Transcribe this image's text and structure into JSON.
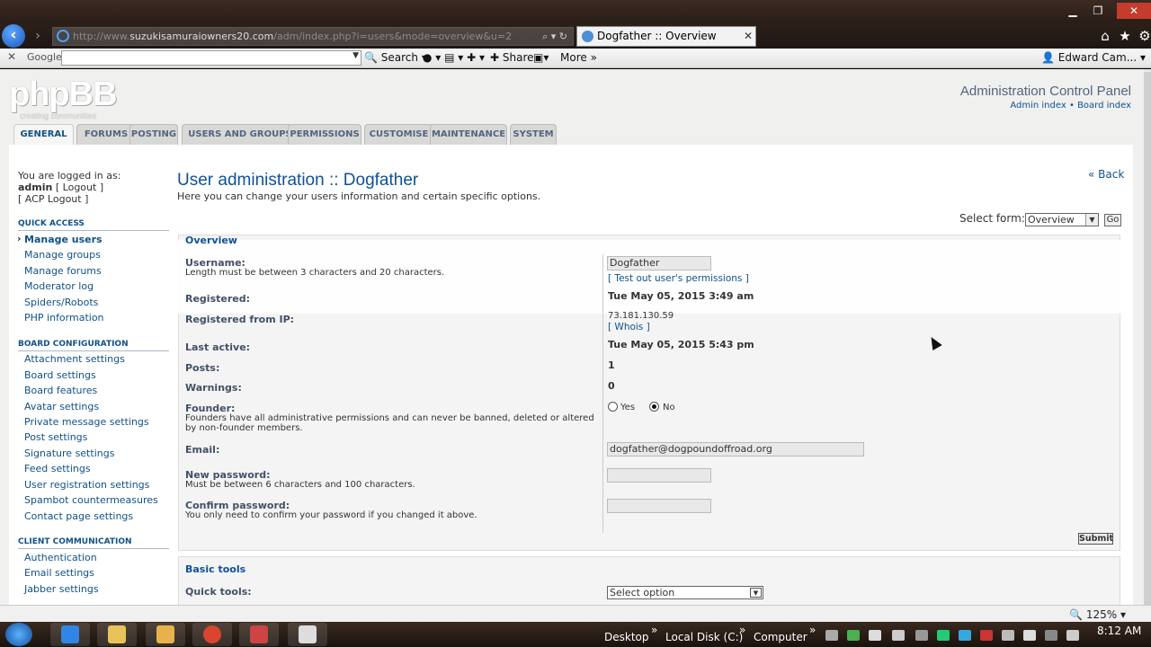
{
  "browser": {
    "address_domain": "suzukisamuraiowners20.com",
    "address_rest": "/adm/index.php?i=users&mode=overview&u=2",
    "tab_title": "Dogfather :: Overview",
    "toolbar_search": "Search",
    "toolbar_share": "Share",
    "toolbar_more": "More",
    "toolbar_user": "Edward Cam...",
    "google_label": "Google",
    "zoom": "125%"
  },
  "header": {
    "logo": "phpBB",
    "logo_tagline": "creating communities",
    "acp_title": "Administration Control Panel",
    "admin_index": "Admin index",
    "board_index": "Board index",
    "bullet": "•"
  },
  "tabs": [
    "GENERAL",
    "FORUMS",
    "POSTING",
    "USERS AND GROUPS",
    "PERMISSIONS",
    "CUSTOMISE",
    "MAINTENANCE",
    "SYSTEM"
  ],
  "sidebar": {
    "logged_in_as": "You are logged in as:",
    "username": "admin",
    "logout": "[ Logout ]",
    "acp_logout": "[ ACP Logout ]",
    "quick_access_title": "QUICK ACCESS",
    "quick_access": [
      "Manage users",
      "Manage groups",
      "Manage forums",
      "Moderator log",
      "Spiders/Robots",
      "PHP information"
    ],
    "board_config_title": "BOARD CONFIGURATION",
    "board_config": [
      "Attachment settings",
      "Board settings",
      "Board features",
      "Avatar settings",
      "Private message settings",
      "Post settings",
      "Signature settings",
      "Feed settings",
      "User registration settings",
      "Spambot countermeasures",
      "Contact page settings"
    ],
    "client_comm_title": "CLIENT COMMUNICATION",
    "client_comm": [
      "Authentication",
      "Email settings",
      "Jabber settings"
    ]
  },
  "content": {
    "title": "User administration :: Dogfather",
    "description": "Here you can change your users information and certain specific options.",
    "back": "« Back",
    "select_form_label": "Select form:",
    "select_form_value": "Overview",
    "go": "Go",
    "overview_legend": "Overview",
    "username_label": "Username:",
    "username_hint": "Length must be between 3 characters and 20 characters.",
    "username_value": "Dogfather",
    "test_permissions": "[ Test out user's permissions ]",
    "registered_label": "Registered:",
    "registered_value": "Tue May 05, 2015 3:49 am",
    "registered_ip_label": "Registered from IP:",
    "registered_ip_value": "73.181.130.59",
    "whois": "[ Whois ]",
    "last_active_label": "Last active:",
    "last_active_value": "Tue May 05, 2015 5:43 pm",
    "posts_label": "Posts:",
    "posts_value": "1",
    "warnings_label": "Warnings:",
    "warnings_value": "0",
    "founder_label": "Founder:",
    "founder_hint": "Founders have all administrative permissions and can never be banned, deleted or altered by non-founder members.",
    "founder_yes": "Yes",
    "founder_no": "No",
    "email_label": "Email:",
    "email_value": "dogfather@dogpoundoffroad.org",
    "new_password_label": "New password:",
    "new_password_hint": "Must be between 6 characters and 100 characters.",
    "confirm_password_label": "Confirm password:",
    "confirm_password_hint": "You only need to confirm your password if you changed it above.",
    "submit": "Submit",
    "basic_tools_legend": "Basic tools",
    "quick_tools_label": "Quick tools:",
    "quick_tools_value": "Select option"
  },
  "taskbar": {
    "desktop": "Desktop",
    "local_disk": "Local Disk (C:)",
    "computer": "Computer",
    "time": "8:12 AM"
  },
  "colors": {
    "link": "#105289",
    "title": "#115098",
    "label": "#425067"
  }
}
